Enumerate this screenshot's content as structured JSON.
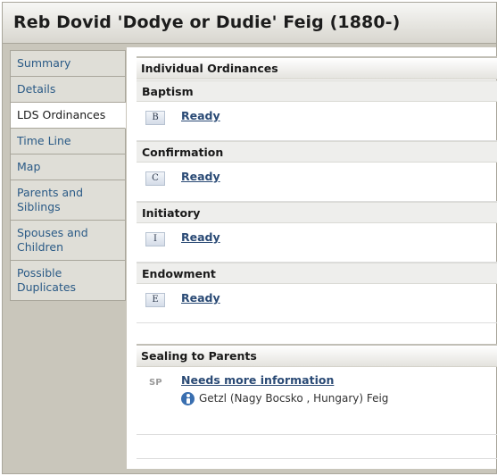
{
  "title": "Reb Dovid 'Dodye or Dudie' Feig (1880-)",
  "sidebar": {
    "items": [
      {
        "label": "Summary"
      },
      {
        "label": "Details"
      },
      {
        "label": "LDS Ordinances"
      },
      {
        "label": "Time Line"
      },
      {
        "label": "Map"
      },
      {
        "label": "Parents and Siblings"
      },
      {
        "label": "Spouses and Children"
      },
      {
        "label": "Possible Duplicates"
      }
    ],
    "active": "LDS Ordinances"
  },
  "main": {
    "individual_header": "Individual Ordinances",
    "ordinances": [
      {
        "name": "Baptism",
        "badge": "B",
        "status": "Ready"
      },
      {
        "name": "Confirmation",
        "badge": "C",
        "status": "Ready"
      },
      {
        "name": "Initiatory",
        "badge": "I",
        "status": "Ready"
      },
      {
        "name": "Endowment",
        "badge": "E",
        "status": "Ready"
      }
    ],
    "sealing": {
      "header": "Sealing to Parents",
      "badge": "SP",
      "status": "Needs more information",
      "parent": "Getzl (Nagy Bocsko , Hungary) Feig",
      "icon": "person-info-icon"
    }
  },
  "colors": {
    "link": "#2a4a75",
    "nav_link": "#2a5a86",
    "frame": "#c9c6bb"
  }
}
